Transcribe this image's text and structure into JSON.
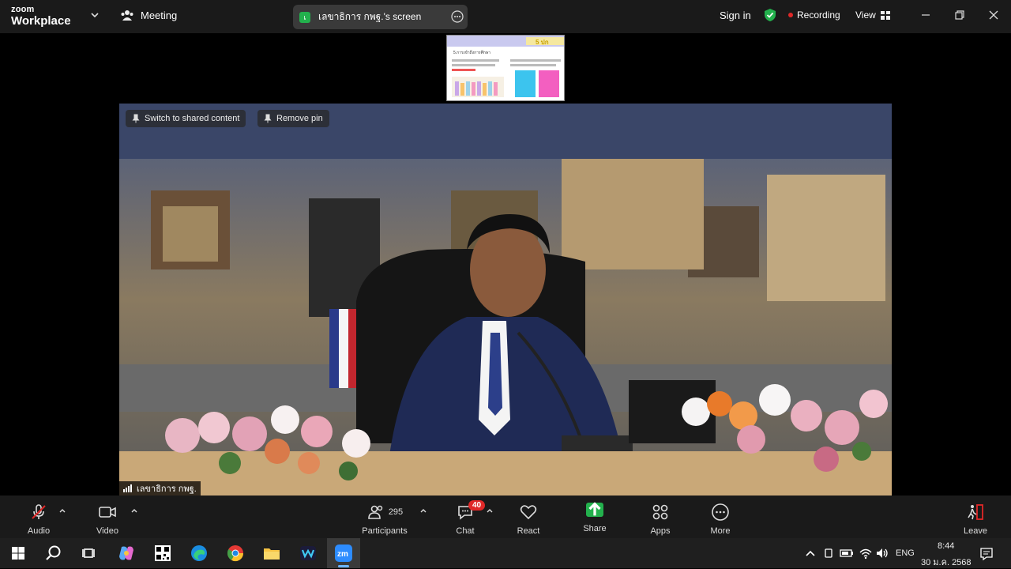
{
  "app": {
    "brand_line1": "zoom",
    "brand_line2": "Workplace",
    "meeting_label": "Meeting"
  },
  "share": {
    "badge": "เ",
    "title": "เลขาธิการ กพฐ.'s screen"
  },
  "header": {
    "signin": "Sign in",
    "recording": "Recording",
    "view": "View"
  },
  "pins": {
    "switch_label": "Switch to shared content",
    "remove_label": "Remove pin"
  },
  "speaker": {
    "name": "เลขาธิการ กพฐ."
  },
  "toolbar": {
    "audio": "Audio",
    "video": "Video",
    "participants": "Participants",
    "participants_count": "295",
    "chat": "Chat",
    "chat_badge": "40",
    "react": "React",
    "share": "Share",
    "apps": "Apps",
    "more": "More",
    "leave": "Leave"
  },
  "slide": {
    "title": "5.การเข้าถึงการศึกษา",
    "number": "5 ปก"
  },
  "taskbar": {
    "lang": "ENG",
    "time": "8:44",
    "date": "30 ม.ค. 2568"
  },
  "colors": {
    "accent_green": "#23b14d",
    "record_red": "#e02828",
    "bar_bg": "#1a1a1a"
  }
}
